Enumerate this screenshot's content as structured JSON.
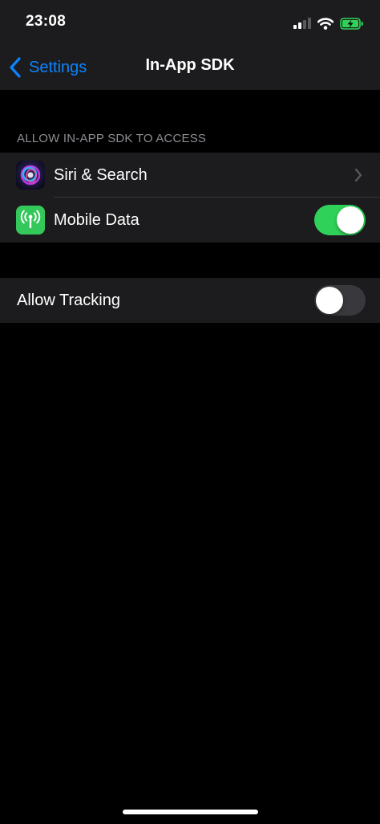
{
  "status_bar": {
    "time": "23:08",
    "icons": [
      "cellular-signal-icon",
      "wifi-icon",
      "battery-charging-icon"
    ]
  },
  "nav": {
    "back_label": "Settings",
    "title": "In-App SDK"
  },
  "section": {
    "header": "ALLOW IN-APP SDK TO ACCESS"
  },
  "rows": [
    {
      "label": "Siri & Search",
      "icon": "siri-icon",
      "accessory": "disclosure"
    },
    {
      "label": "Mobile Data",
      "icon": "cellular-antenna-icon",
      "accessory": "toggle",
      "on": true
    }
  ],
  "tracking": {
    "label": "Allow Tracking",
    "on": false
  },
  "colors": {
    "accent": "#0a84ff",
    "toggle_on": "#30d158",
    "toggle_off": "#39393d",
    "cell_background": "#1c1c1e",
    "page_background": "#000000"
  }
}
